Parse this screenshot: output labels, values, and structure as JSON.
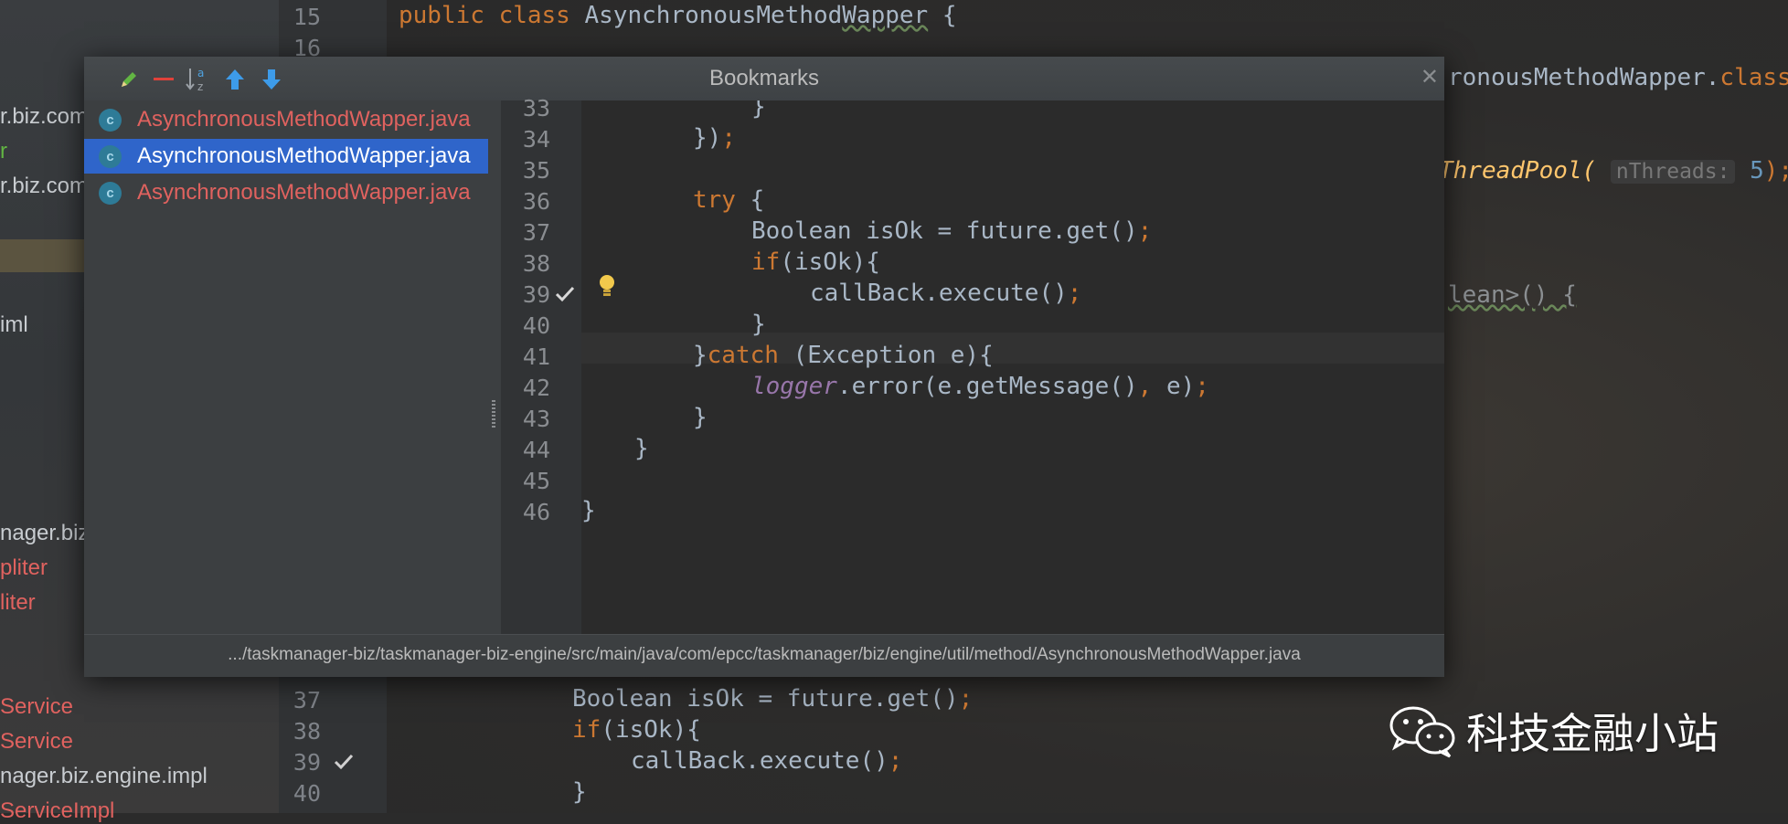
{
  "popup": {
    "title": "Bookmarks",
    "status_path": ".../taskmanager-biz/taskmanager-biz-engine/src/main/java/com/epcc/taskmanager/biz/engine/util/method/AsynchronousMethodWapper.java",
    "list": [
      {
        "label": "AsynchronousMethodWapper.java",
        "icon": "class-icon",
        "color": "#e0625f",
        "selected": false
      },
      {
        "label": "AsynchronousMethodWapper.java",
        "icon": "class-icon",
        "color": "#ffffff",
        "selected": true
      },
      {
        "label": "AsynchronousMethodWapper.java",
        "icon": "class-icon",
        "color": "#e0625f",
        "selected": false
      }
    ],
    "line_numbers": [
      "33",
      "34",
      "35",
      "36",
      "37",
      "38",
      "39",
      "40",
      "41",
      "42",
      "43",
      "44",
      "45",
      "46"
    ],
    "bookmark_line": "39"
  },
  "background": {
    "tree": [
      {
        "text": "r.biz.com",
        "color": "#c8ccd0"
      },
      {
        "text": "r",
        "color": "#62b543"
      },
      {
        "text": "r.biz.com",
        "color": "#c8ccd0"
      },
      {
        "text": "iml",
        "color": "#c8ccd0"
      },
      {
        "text": "nager.biz.",
        "color": "#c8ccd0"
      },
      {
        "text": "pliter",
        "color": "#e0625f"
      },
      {
        "text": "liter",
        "color": "#e0625f"
      },
      {
        "text": "Service",
        "color": "#e0625f"
      },
      {
        "text": "Service",
        "color": "#e0625f"
      },
      {
        "text": "nager.biz.engine.impl",
        "color": "#c8ccd0"
      },
      {
        "text": "ServiceImpl",
        "color": "#e0625f"
      }
    ],
    "line_numbers_top": [
      "15",
      "16"
    ],
    "line_numbers_bottom": [
      "37",
      "38",
      "39",
      "40"
    ],
    "right_fragments": {
      "class_ref": "ronousMethodWapper.",
      "class_kw": "class",
      "pool_call": "ThreadPool(",
      "pool_hint": "nThreads:",
      "pool_arg": "5",
      "generic": "lean>() {"
    }
  },
  "watermark": {
    "text": "科技金融小站"
  },
  "colors": {
    "keyword": "#cc7832",
    "selection": "#2f65ca",
    "error_file": "#e0625f",
    "number": "#6897bb"
  }
}
